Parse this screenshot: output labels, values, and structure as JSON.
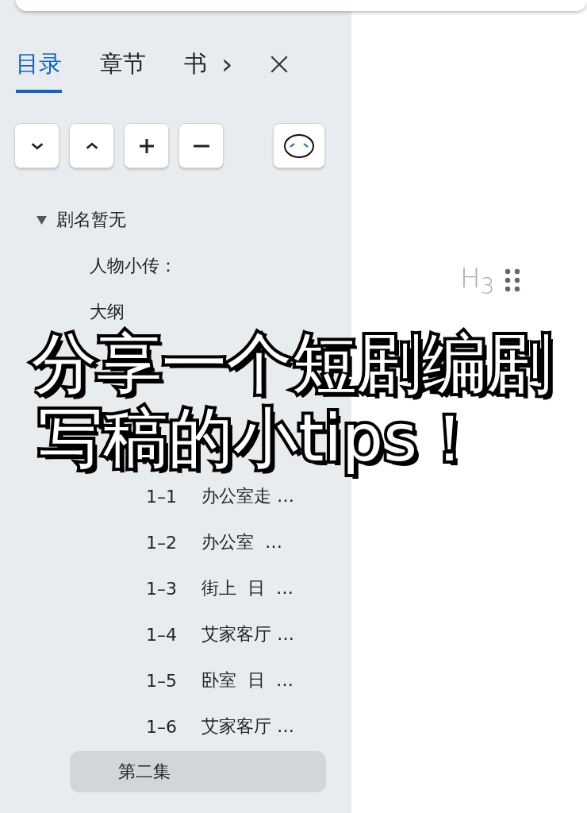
{
  "tabs": [
    {
      "label": "目录",
      "selected": true
    },
    {
      "label": "章节",
      "selected": false
    },
    {
      "label": "书",
      "selected": false
    }
  ],
  "tabs_more": "›",
  "toolbar": [
    {
      "kind": "down"
    },
    {
      "kind": "up"
    },
    {
      "kind": "plus"
    },
    {
      "kind": "minus"
    },
    {
      "kind": "face"
    }
  ],
  "tree": {
    "label": "剧名暂无",
    "expanded": true,
    "children": [
      {
        "label": "人物小传："
      },
      {
        "label": "大纲"
      }
    ]
  },
  "scenes": [
    {
      "number": "1–1",
      "title": "办公室走 …"
    },
    {
      "number": "1–2",
      "title": "办公室  …"
    },
    {
      "number": "1–3",
      "title": "街上  日  …"
    },
    {
      "number": "1–4",
      "title": "艾家客厅 …"
    },
    {
      "number": "1–5",
      "title": "卧室  日  …"
    },
    {
      "number": "1–6",
      "title": "艾家客厅 …"
    }
  ],
  "episodes": [
    {
      "label": "第二集",
      "selected": true
    }
  ],
  "heading_marker": "H$_{3}$",
  "caption": [
    "分享一个短剧编剧",
    "写稿的小tips！"
  ]
}
